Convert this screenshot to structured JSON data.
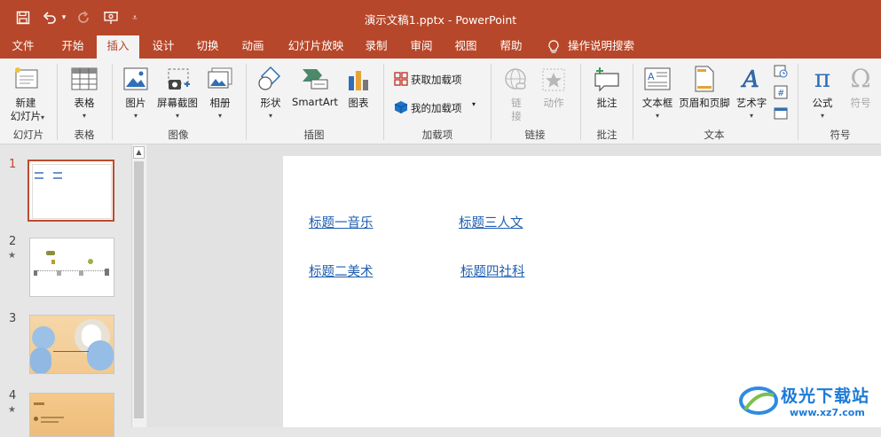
{
  "window": {
    "title": "演示文稿1.pptx  -  PowerPoint"
  },
  "tabs": [
    {
      "label": "文件"
    },
    {
      "label": "开始"
    },
    {
      "label": "插入",
      "active": true
    },
    {
      "label": "设计"
    },
    {
      "label": "切换"
    },
    {
      "label": "动画"
    },
    {
      "label": "幻灯片放映"
    },
    {
      "label": "录制"
    },
    {
      "label": "审阅"
    },
    {
      "label": "视图"
    },
    {
      "label": "帮助"
    },
    {
      "label": "操作说明搜索"
    }
  ],
  "ribbon": {
    "new_slide": {
      "label1": "新建",
      "label2": "幻灯片"
    },
    "table": {
      "label": "表格"
    },
    "picture": {
      "label": "图片"
    },
    "screenshot": {
      "label": "屏幕截图"
    },
    "album": {
      "label": "相册"
    },
    "shapes": {
      "label": "形状"
    },
    "smartart": {
      "label": "SmartArt"
    },
    "chart": {
      "label": "图表"
    },
    "get_addins": {
      "label": "获取加载项"
    },
    "my_addins": {
      "label": "我的加载项"
    },
    "link": {
      "label": "链接"
    },
    "action": {
      "label": "动作"
    },
    "comment": {
      "label": "批注"
    },
    "textbox": {
      "label": "文本框"
    },
    "header_footer": {
      "label": "页眉和页脚"
    },
    "wordart": {
      "label": "艺术字"
    },
    "equation": {
      "label": "公式"
    },
    "symbol": {
      "label": "符号"
    },
    "groups": {
      "slides": "幻灯片",
      "tables": "表格",
      "images": "图像",
      "illustrations": "插图",
      "addins": "加载项",
      "links": "链接",
      "comments": "批注",
      "text": "文本",
      "symbols": "符号"
    }
  },
  "thumbnails": [
    {
      "number": "1",
      "star": ""
    },
    {
      "number": "2",
      "star": "★"
    },
    {
      "number": "3",
      "star": ""
    },
    {
      "number": "4",
      "star": "★"
    }
  ],
  "slide": {
    "links": [
      {
        "text": "标题一音乐"
      },
      {
        "text": "标题三人文"
      },
      {
        "text": "标题二美术"
      },
      {
        "text": "标题四社科"
      }
    ]
  },
  "watermark": {
    "title": "极光下载站",
    "url": "www.xz7.com"
  },
  "colors": {
    "accent": "#b7472a",
    "link": "#1f5fb0",
    "selected_thumb_border": "#c0492b"
  }
}
